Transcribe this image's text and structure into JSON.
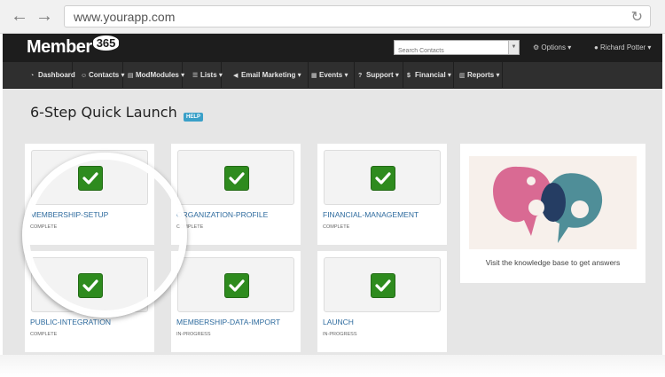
{
  "browser": {
    "url": "www.yourapp.com",
    "back_icon": "←",
    "forward_icon": "→",
    "reload_icon": "↻"
  },
  "header": {
    "logo_text": "Member",
    "logo_badge": "365",
    "search_placeholder": "Search Contacts",
    "options_label": "⚙ Options ▾",
    "user_label": "● Richard Potter ▾"
  },
  "menu": [
    {
      "label": "Dashboard",
      "icon": "dashboard-icon",
      "glyph": "◔"
    },
    {
      "label": "Contacts ▾",
      "icon": "contacts-icon",
      "glyph": "☺"
    },
    {
      "label": "ModModules ▾",
      "icon": "modules-icon",
      "glyph": "▤"
    },
    {
      "label": "Lists ▾",
      "icon": "lists-icon",
      "glyph": "☰"
    },
    {
      "label": "Email Marketing ▾",
      "icon": "megaphone-icon",
      "glyph": "◀"
    },
    {
      "label": "Events ▾",
      "icon": "calendar-icon",
      "glyph": "▦"
    },
    {
      "label": "Support ▾",
      "icon": "help-icon",
      "glyph": "?"
    },
    {
      "label": "Financial ▾",
      "icon": "money-icon",
      "glyph": "$"
    },
    {
      "label": "Reports ▾",
      "icon": "chart-icon",
      "glyph": "▥"
    }
  ],
  "main": {
    "title": "6-Step Quick Launch",
    "help_badge": "HELP",
    "steps": [
      {
        "name": "MEMBERSHIP-SETUP",
        "status": "COMPLETE"
      },
      {
        "name": "ORGANIZATION-PROFILE",
        "status": "COMPLETE"
      },
      {
        "name": "FINANCIAL-MANAGEMENT",
        "status": "COMPLETE"
      },
      {
        "name": "PUBLIC-INTEGRATION",
        "status": "COMPLETE"
      },
      {
        "name": "MEMBERSHIP-DATA-IMPORT",
        "status": "IN-PROGRESS"
      },
      {
        "name": "LAUNCH",
        "status": "IN-PROGRESS"
      }
    ],
    "knowledge_base": "Visit the knowledge base to get answers"
  },
  "colors": {
    "header_bg": "#1d1d1d",
    "menu_bg": "#2f2f2f",
    "check_green": "#2e8b1e",
    "link_blue": "#2e6b9e",
    "help_blue": "#3aa0c8"
  }
}
